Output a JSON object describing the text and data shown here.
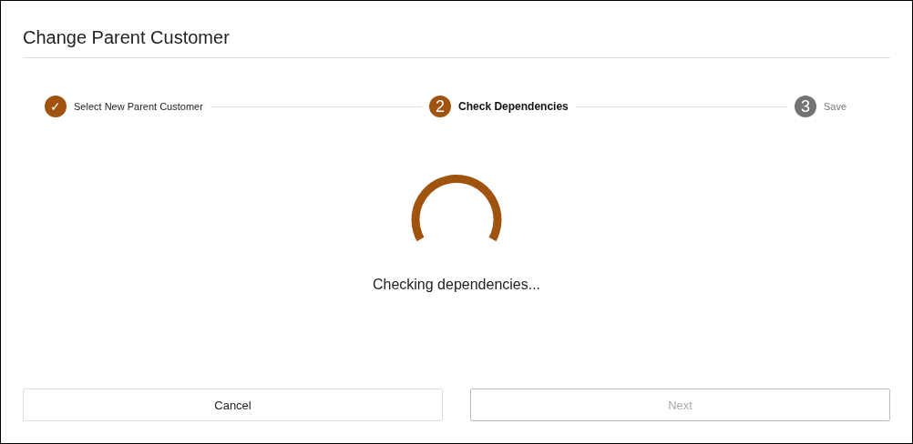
{
  "dialog": {
    "title": "Change Parent Customer"
  },
  "steps": [
    {
      "marker": "✓",
      "label": "Select New Parent Customer",
      "kind": "done"
    },
    {
      "marker": "2",
      "label": "Check Dependencies",
      "kind": "current"
    },
    {
      "marker": "3",
      "label": "Save",
      "kind": "upcoming"
    }
  ],
  "status": {
    "message": "Checking dependencies..."
  },
  "buttons": [
    {
      "label": "Cancel",
      "disabled": false
    },
    {
      "label": "Next",
      "disabled": true
    }
  ]
}
